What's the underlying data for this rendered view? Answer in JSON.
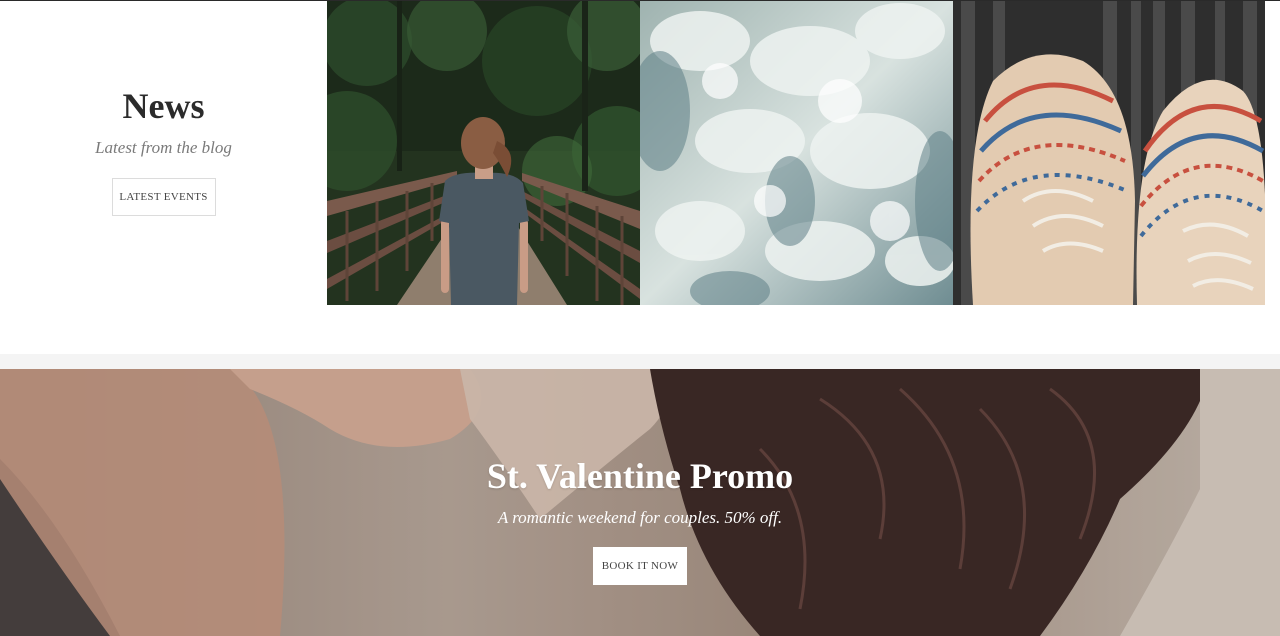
{
  "news": {
    "title": "News",
    "subtitle": "Latest from the blog",
    "button_label": "LATEST EVENTS"
  },
  "gallery": [
    {
      "image": "woman-on-forest-bridge"
    },
    {
      "image": "waterfall-foam"
    },
    {
      "image": "embroidered-shoes-on-wood"
    }
  ],
  "promo": {
    "title": "St. Valentine Promo",
    "subtitle": "A romantic weekend for couples. 50% off.",
    "button_label": "BOOK IT NOW"
  },
  "colors": {
    "heading": "#2b2b2b",
    "muted": "#7a7a7a",
    "divider": "#f4f4f4",
    "button_border": "#dcdcdc"
  }
}
